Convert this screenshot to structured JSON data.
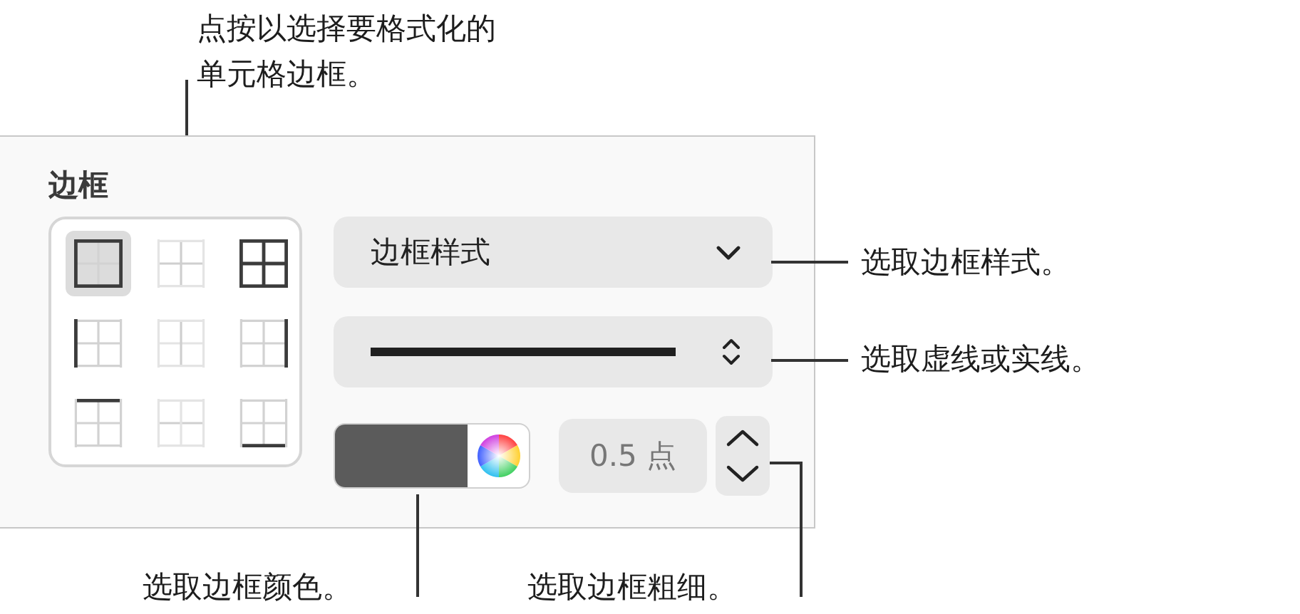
{
  "callouts": {
    "top": "点按以选择要格式化的单元格边框。",
    "style": "选取边框样式。",
    "line": "选取虚线或实线。",
    "border_color": "选取边框颜色。",
    "width": "选取边框粗细。"
  },
  "panel": {
    "title": "边框",
    "border_buttons": [
      {
        "kind": "outer",
        "selected": true
      },
      {
        "kind": "inner",
        "selected": false
      },
      {
        "kind": "all",
        "selected": false
      },
      {
        "kind": "left",
        "selected": false
      },
      {
        "kind": "inner-vertical",
        "selected": false
      },
      {
        "kind": "right",
        "selected": false
      },
      {
        "kind": "top",
        "selected": false
      },
      {
        "kind": "inner-horizontal",
        "selected": false
      },
      {
        "kind": "bottom",
        "selected": false
      }
    ],
    "style_dropdown": {
      "value": "边框样式"
    },
    "color_well": {
      "color": "#5b5b5b"
    },
    "width_stepper": {
      "value": "0.5 点"
    }
  }
}
